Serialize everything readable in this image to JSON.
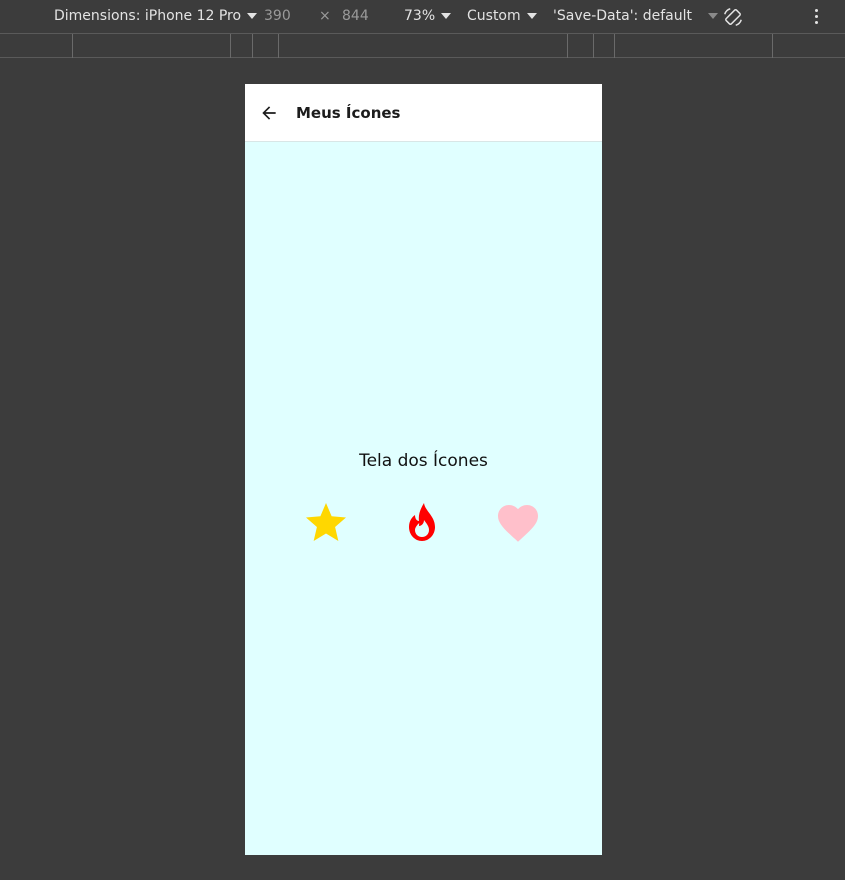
{
  "devtools": {
    "dimensions_label": "Dimensions: iPhone 12 Pro",
    "width": "390",
    "times": "×",
    "height": "844",
    "zoom": "73%",
    "throttle": "Custom",
    "save_data": "'Save-Data': default"
  },
  "app": {
    "title": "Meus Ícones",
    "body_text": "Tela dos Ícones"
  },
  "icons": [
    {
      "name": "star-icon",
      "color": "#ffd700"
    },
    {
      "name": "fire-icon",
      "color": "#ff0000"
    },
    {
      "name": "heart-icon",
      "color": "#ffc0cb"
    }
  ],
  "colors": {
    "screen_background": "#e0ffff",
    "appbar_background": "#ffffff",
    "devtools_background": "#3c3c3c"
  }
}
